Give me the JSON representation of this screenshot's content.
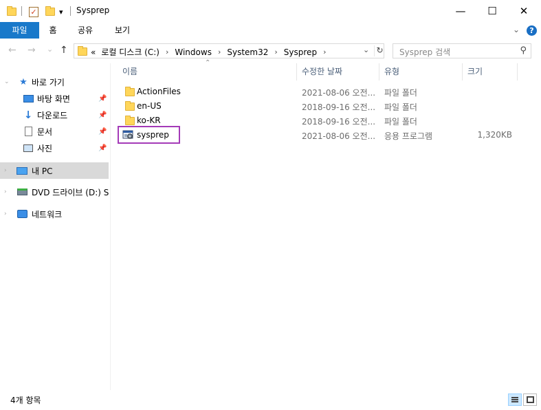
{
  "window": {
    "title": "Sysprep",
    "minimize_glyph": "—",
    "maximize_glyph": "☐",
    "close_glyph": "✕"
  },
  "quick_access_toolbar": {
    "dropdown_glyph": "▾"
  },
  "ribbon": {
    "tabs": [
      "파일",
      "홈",
      "공유",
      "보기"
    ],
    "expand_glyph": "⌄",
    "help_glyph": "?"
  },
  "address_bar": {
    "back_glyph": "←",
    "forward_glyph": "→",
    "recent_glyph": "⌄",
    "up_glyph": "↑",
    "overflow": "«",
    "crumbs": [
      "로컬 디스크 (C:)",
      "Windows",
      "System32",
      "Sysprep"
    ],
    "crumb_separator": "›",
    "dropdown_glyph": "⌄",
    "refresh_glyph": "↻"
  },
  "search": {
    "placeholder": "Sysprep 검색",
    "icon_glyph": "⚲"
  },
  "nav_pane": {
    "items": [
      {
        "label": "바로 가기"
      },
      {
        "label": "바탕 화면"
      },
      {
        "label": "다운로드"
      },
      {
        "label": "문서"
      },
      {
        "label": "사진"
      },
      {
        "label": "내 PC"
      },
      {
        "label": "DVD 드라이브 (D:) S"
      },
      {
        "label": "네트워크"
      }
    ],
    "pin_glyph": "📌"
  },
  "columns": {
    "name": "이름",
    "modified": "수정한 날짜",
    "type": "유형",
    "size": "크기",
    "sort_glyph": "⌃"
  },
  "files": [
    {
      "name": "ActionFiles",
      "modified": "2021-08-06 오전...",
      "type": "파일 폴더",
      "size": ""
    },
    {
      "name": "en-US",
      "modified": "2018-09-16 오전...",
      "type": "파일 폴더",
      "size": ""
    },
    {
      "name": "ko-KR",
      "modified": "2018-09-16 오전...",
      "type": "파일 폴더",
      "size": ""
    },
    {
      "name": "sysprep",
      "modified": "2021-08-06 오전...",
      "type": "응용 프로그램",
      "size": "1,320KB"
    }
  ],
  "status": {
    "item_count": "4개 항목"
  },
  "colors": {
    "file_tab": "#1979ca",
    "highlight_box": "#a43ab8",
    "selected_nav": "#d9d9d9",
    "column_header_text": "#4c607a"
  }
}
